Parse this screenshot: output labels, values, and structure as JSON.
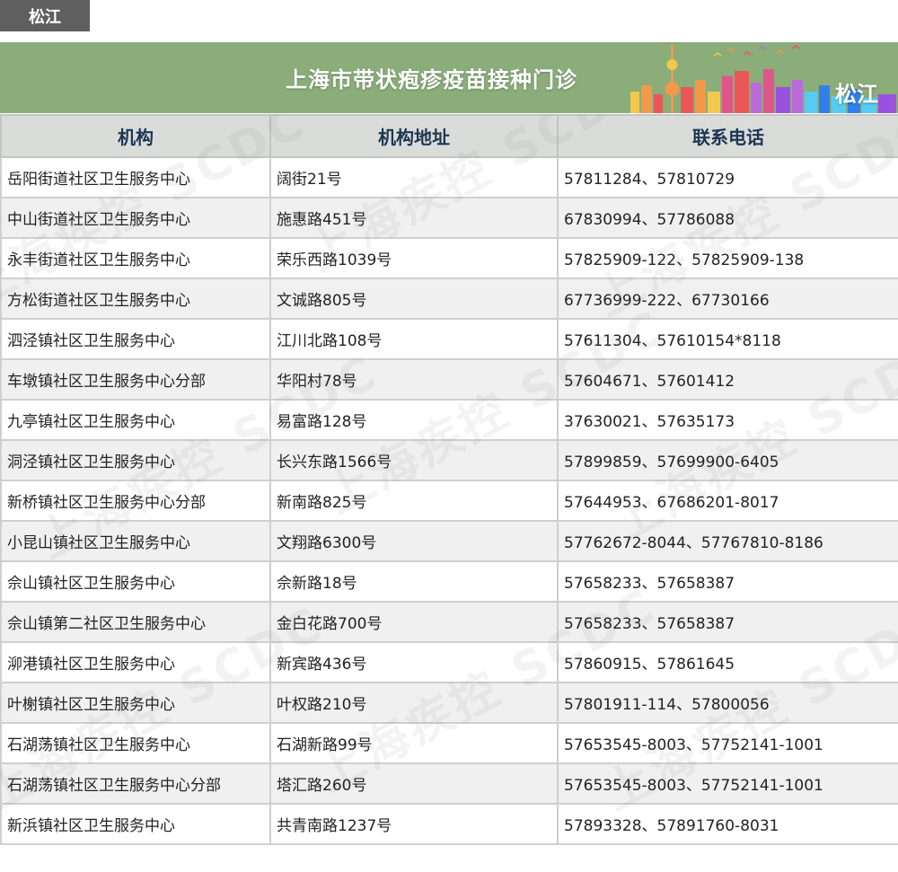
{
  "district_tag": "松江",
  "banner": {
    "title": "上海市带状疱疹疫苗接种门诊",
    "district": "松江"
  },
  "table": {
    "headers": [
      "机构",
      "机构地址",
      "联系电话"
    ],
    "rows": [
      [
        "岳阳街道社区卫生服务中心",
        "阔街21号",
        "57811284、57810729"
      ],
      [
        "中山街道社区卫生服务中心",
        "施惠路451号",
        "67830994、57786088"
      ],
      [
        "永丰街道社区卫生服务中心",
        "荣乐西路1039号",
        "57825909-122、57825909-138"
      ],
      [
        "方松街道社区卫生服务中心",
        "文诚路805号",
        "67736999-222、67730166"
      ],
      [
        "泗泾镇社区卫生服务中心",
        "江川北路108号",
        "57611304、57610154*8118"
      ],
      [
        "车墩镇社区卫生服务中心分部",
        "华阳村78号",
        "57604671、57601412"
      ],
      [
        "九亭镇社区卫生服务中心",
        "易富路128号",
        "37630021、57635173"
      ],
      [
        "洞泾镇社区卫生服务中心",
        "长兴东路1566号",
        "57899859、57699900-6405"
      ],
      [
        "新桥镇社区卫生服务中心分部",
        "新南路825号",
        "57644953、67686201-8017"
      ],
      [
        "小昆山镇社区卫生服务中心",
        "文翔路6300号",
        "57762672-8044、57767810-8186"
      ],
      [
        "佘山镇社区卫生服务中心",
        "佘新路18号",
        "57658233、57658387"
      ],
      [
        "佘山镇第二社区卫生服务中心",
        "金白花路700号",
        "57658233、57658387"
      ],
      [
        "泖港镇社区卫生服务中心",
        "新宾路436号",
        "57860915、57861645"
      ],
      [
        "叶榭镇社区卫生服务中心",
        "叶权路210号",
        "57801911-114、57800056"
      ],
      [
        "石湖荡镇社区卫生服务中心",
        "石湖新路99号",
        "57653545-8003、57752141-1001"
      ],
      [
        "石湖荡镇社区卫生服务中心分部",
        "塔汇路260号",
        "57653545-8003、57752141-1001"
      ],
      [
        "新浜镇社区卫生服务中心",
        "共青南路1237号",
        "57893328、57891760-8031"
      ]
    ]
  },
  "watermark_text": "上海疾控 SCDC",
  "colors": {
    "banner_bg": "#8aad7a",
    "header_bg": "#d9dcd9",
    "header_text": "#1f3553",
    "tag_bg": "#5f5f5f"
  }
}
